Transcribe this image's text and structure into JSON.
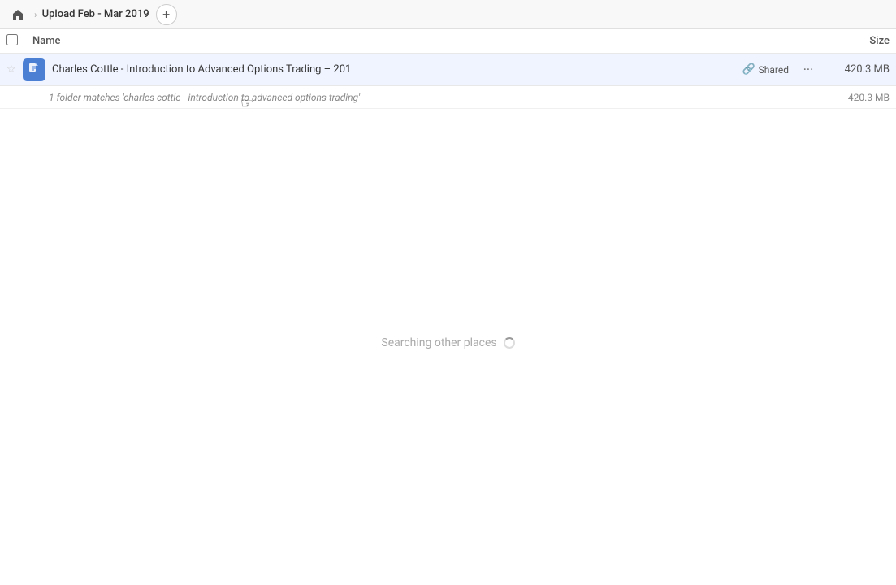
{
  "topbar": {
    "home_title": "Home",
    "breadcrumb_separator": "›",
    "folder_title": "Upload Feb - Mar 2019",
    "add_tab_label": "+"
  },
  "columns": {
    "name_label": "Name",
    "size_label": "Size"
  },
  "file_row": {
    "name": "Charles Cottle - Introduction to Advanced Options Trading – 201",
    "shared_label": "Shared",
    "size": "420.3 MB",
    "more_label": "···"
  },
  "match_row": {
    "text": "1 folder matches 'charles cottle - introduction to advanced options trading'",
    "size": "420.3 MB"
  },
  "searching": {
    "label": "Searching other places"
  }
}
